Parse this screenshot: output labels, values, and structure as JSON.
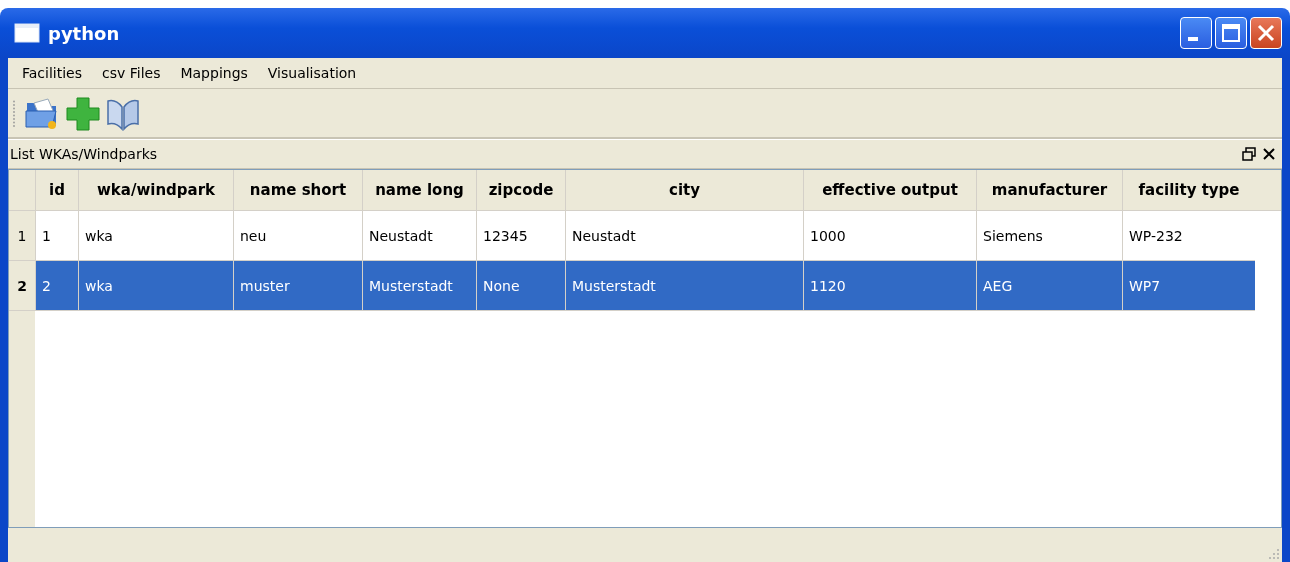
{
  "window": {
    "title": "python"
  },
  "menu": [
    "Facilities",
    "csv Files",
    "Mappings",
    "Visualisation"
  ],
  "dock": {
    "title": "List WKAs/Windparks"
  },
  "table": {
    "columns": [
      "id",
      "wka/windpark",
      "name short",
      "name long",
      "zipcode",
      "city",
      "effective output",
      "manufacturer",
      "facility type"
    ],
    "rows": [
      {
        "header": "1",
        "selected": false,
        "cells": [
          "1",
          "wka",
          "neu",
          "Neustadt",
          "12345",
          "Neustadt",
          "1000",
          "Siemens",
          "WP-232"
        ]
      },
      {
        "header": "2",
        "selected": true,
        "cells": [
          "2",
          "wka",
          "muster",
          "Musterstadt",
          "None",
          "Musterstadt",
          "1120",
          "AEG",
          "WP7"
        ]
      }
    ]
  }
}
